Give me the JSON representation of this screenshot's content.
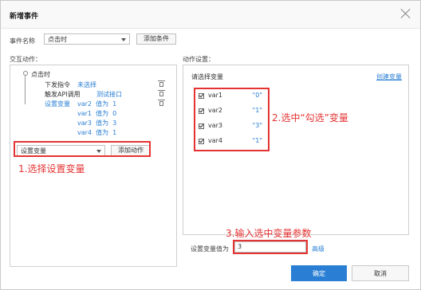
{
  "dialog": {
    "title": "新增事件"
  },
  "event": {
    "name_label": "事件名称",
    "name_value": "点击时",
    "add_condition": "添加条件"
  },
  "interaction": {
    "section_label": "交互动作：",
    "root": "点击时",
    "actions": [
      {
        "label": "下发指令",
        "value": "未选择"
      },
      {
        "label": "触发API调用",
        "value": "测试接口"
      },
      {
        "label": "设置变量",
        "value": "var2  值为  1"
      }
    ],
    "sub_vars": [
      "var1  值为  0",
      "var3  值为  3",
      "var4  值为  1"
    ],
    "action_select": "设置变量",
    "add_action": "添加动作"
  },
  "settings": {
    "section_label": "动作设置：",
    "choose_label": "请选择变量",
    "create_link": "创建变量",
    "vars": [
      {
        "name": "var1",
        "value": "\"0\""
      },
      {
        "name": "var2",
        "value": "\"1\""
      },
      {
        "name": "var3",
        "value": "\"3\""
      },
      {
        "name": "var4",
        "value": "\"1\""
      }
    ],
    "value_label": "设置变量值为",
    "value_input": "3",
    "advanced": "高级"
  },
  "annotations": {
    "a1": "1.选择设置变量",
    "a2": "2.选中“勾选”变量",
    "a3": "3.输入选中变量参数"
  },
  "footer": {
    "ok": "确定",
    "cancel": "取消"
  },
  "colors": {
    "accent": "#2a7fd4",
    "annotation": "#e53333"
  }
}
